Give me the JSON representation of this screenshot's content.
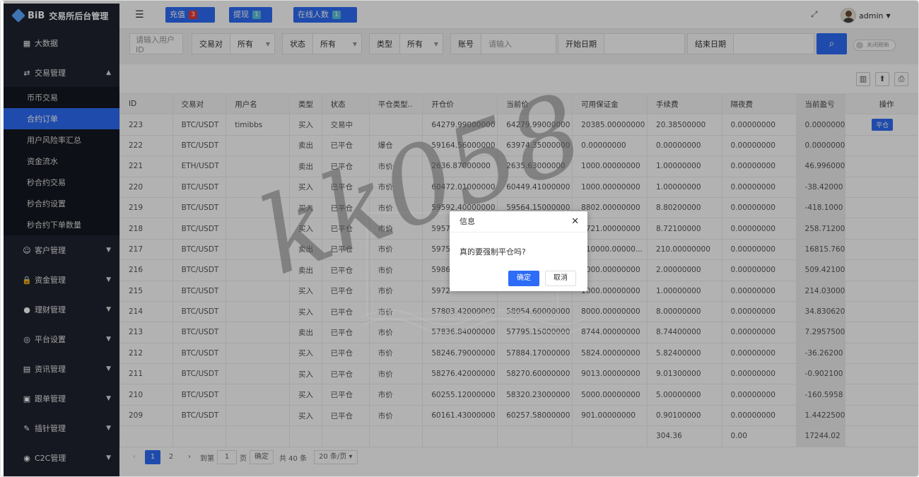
{
  "brand": {
    "logo": "BiB",
    "title": "交易所后台管理"
  },
  "sidebar": {
    "top_items": [
      {
        "label": "大数据",
        "icon": "chart-icon"
      }
    ],
    "trade": {
      "label": "交易管理",
      "icon": "exchange-icon",
      "expanded": true,
      "children": [
        "币币交易",
        "合约订单",
        "用户风险率汇总",
        "资金流水",
        "秒合约交易",
        "秒合约设置",
        "秒合约下单数量"
      ],
      "active": "合约订单"
    },
    "groups": [
      {
        "label": "客户管理",
        "icon": "users-icon"
      },
      {
        "label": "资金管理",
        "icon": "lock-icon"
      },
      {
        "label": "理财管理",
        "icon": "piggy-icon"
      },
      {
        "label": "平台设置",
        "icon": "settings-icon"
      },
      {
        "label": "资讯管理",
        "icon": "news-icon"
      },
      {
        "label": "跟单管理",
        "icon": "clipboard-icon"
      },
      {
        "label": "插针管理",
        "icon": "pin-icon"
      },
      {
        "label": "C2C管理",
        "icon": "c2c-icon"
      }
    ]
  },
  "topbar": {
    "deposit": {
      "label": "充值",
      "count": "3"
    },
    "withdraw": {
      "label": "提现",
      "count": "1"
    },
    "online": {
      "label": "在线人数",
      "count": "1"
    },
    "user": "admin"
  },
  "filters": {
    "user_id_placeholder": "请输入用户ID",
    "pair_label": "交易对",
    "pair_value": "所有",
    "status_label": "状态",
    "status_value": "所有",
    "type_label": "类型",
    "type_value": "所有",
    "account_label": "账号",
    "account_placeholder": "请输入",
    "start_label": "开始日期",
    "end_label": "结束日期",
    "auto_refresh": "关闭刷新"
  },
  "table": {
    "headers": [
      "ID",
      "交易对",
      "用户名",
      "类型",
      "状态",
      "平仓类型..",
      "开仓价",
      "当前价",
      "可用保证金",
      "手续费",
      "隔夜费",
      "当前盈亏",
      "操作"
    ],
    "rows": [
      [
        "223",
        "BTC/USDT",
        "timibbs",
        "买入",
        "交易中",
        "",
        "64279.99000000",
        "64279.99000000",
        "20385.00000000",
        "20.38500000",
        "0.00000000",
        "0.0000000"
      ],
      [
        "222",
        "BTC/USDT",
        "",
        "卖出",
        "已平仓",
        "爆仓",
        "59164.56000000",
        "63974.35000000",
        "0.00000000",
        "0.00000000",
        "0.00000000",
        "0.0000000"
      ],
      [
        "221",
        "ETH/USDT",
        "",
        "卖出",
        "已平仓",
        "市价",
        "2636.87000000",
        "2635.63000000",
        "1000.00000000",
        "1.00000000",
        "0.00000000",
        "46.996000"
      ],
      [
        "220",
        "BTC/USDT",
        "",
        "买入",
        "已平仓",
        "市价",
        "60472.01000000",
        "60449.41000000",
        "1000.00000000",
        "1.00000000",
        "0.00000000",
        "-38.42000"
      ],
      [
        "219",
        "BTC/USDT",
        "",
        "买入",
        "已平仓",
        "市价",
        "59592.40000000",
        "59564.15000000",
        "8802.00000000",
        "8.80200000",
        "0.00000000",
        "-418.1000"
      ],
      [
        "218",
        "BTC/USDT",
        "",
        "买入",
        "已平仓",
        "市价",
        "5957",
        "",
        "8721.00000000",
        "8.72100000",
        "0.00000000",
        "258.71200"
      ],
      [
        "217",
        "BTC/USDT",
        "",
        "卖出",
        "已平仓",
        "市价",
        "5975",
        "",
        "210000.00000...",
        "210.00000000",
        "0.00000000",
        "16815.760"
      ],
      [
        "216",
        "BTC/USDT",
        "",
        "卖出",
        "已平仓",
        "市价",
        "5986",
        "",
        "2000.00000000",
        "2.00000000",
        "0.00000000",
        "509.42100"
      ],
      [
        "215",
        "BTC/USDT",
        "",
        "买入",
        "已平仓",
        "市价",
        "5972",
        "",
        "1000.00000000",
        "1.00000000",
        "0.00000000",
        "214.03000"
      ],
      [
        "214",
        "BTC/USDT",
        "",
        "买入",
        "已平仓",
        "市价",
        "57803.42000000",
        "58054.60000000",
        "8000.00000000",
        "8.00000000",
        "0.00000000",
        "34.830620"
      ],
      [
        "213",
        "BTC/USDT",
        "",
        "卖出",
        "已平仓",
        "市价",
        "57836.84000000",
        "57795.15000000",
        "8744.00000000",
        "8.74400000",
        "0.00000000",
        "7.2957500"
      ],
      [
        "212",
        "BTC/USDT",
        "",
        "买入",
        "已平仓",
        "市价",
        "58246.79000000",
        "57884.17000000",
        "5824.00000000",
        "5.82400000",
        "0.00000000",
        "-36.26200"
      ],
      [
        "211",
        "BTC/USDT",
        "",
        "买入",
        "已平仓",
        "市价",
        "58276.42000000",
        "58270.60000000",
        "9013.00000000",
        "9.01300000",
        "0.00000000",
        "-0.902100"
      ],
      [
        "210",
        "BTC/USDT",
        "",
        "买入",
        "已平仓",
        "市价",
        "60255.12000000",
        "58320.23000000",
        "5000.00000000",
        "5.00000000",
        "0.00000000",
        "-160.5958"
      ],
      [
        "209",
        "BTC/USDT",
        "",
        "买入",
        "已平仓",
        "市价",
        "60161.43000000",
        "60257.58000000",
        "901.00000000",
        "0.90100000",
        "0.00000000",
        "1.4422500"
      ]
    ],
    "action_label": "平仓",
    "totals": {
      "fee": "304.36",
      "overnight": "0.00",
      "pnl": "17244.02"
    }
  },
  "pager": {
    "page1": "1",
    "page2": "2",
    "goto": "到第",
    "page_input": "1",
    "page_unit": "页",
    "confirm": "确定",
    "total": "共 40 条",
    "per_page": "20 条/页"
  },
  "dialog": {
    "title": "信息",
    "message": "真的要强制平仓吗?",
    "ok": "确定",
    "cancel": "取消"
  },
  "watermark_text": "kk058"
}
